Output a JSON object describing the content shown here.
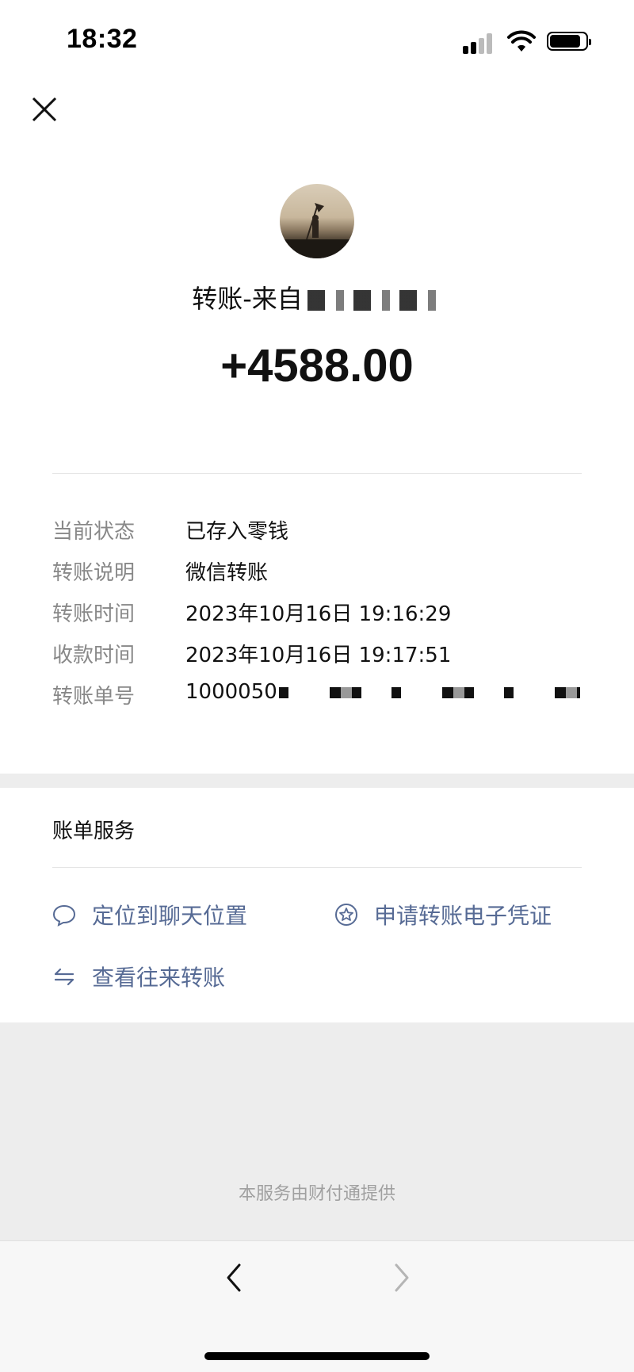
{
  "status_bar": {
    "time": "18:32"
  },
  "transfer": {
    "title": "转账-来自",
    "amount": "+4588.00"
  },
  "details": [
    {
      "label": "当前状态",
      "value": "已存入零钱"
    },
    {
      "label": "转账说明",
      "value": "微信转账"
    },
    {
      "label": "转账时间",
      "value": "2023年10月16日 19:16:29"
    },
    {
      "label": "收款时间",
      "value": "2023年10月16日 19:17:51"
    },
    {
      "label": "转账单号",
      "value": "1000050"
    }
  ],
  "bill_services": {
    "title": "账单服务",
    "locate_chat": "定位到聊天位置",
    "apply_voucher": "申请转账电子凭证",
    "view_transfers": "查看往来转账"
  },
  "footer": {
    "note": "本服务由财付通提供"
  },
  "colors": {
    "link": "#576b95",
    "label": "#888888",
    "background_grey": "#ededed"
  },
  "icons": [
    "close-icon",
    "signal-icon",
    "wifi-icon",
    "battery-icon",
    "chat-bubble-icon",
    "star-badge-icon",
    "swap-arrows-icon",
    "back-arrow-icon",
    "forward-arrow-icon"
  ]
}
